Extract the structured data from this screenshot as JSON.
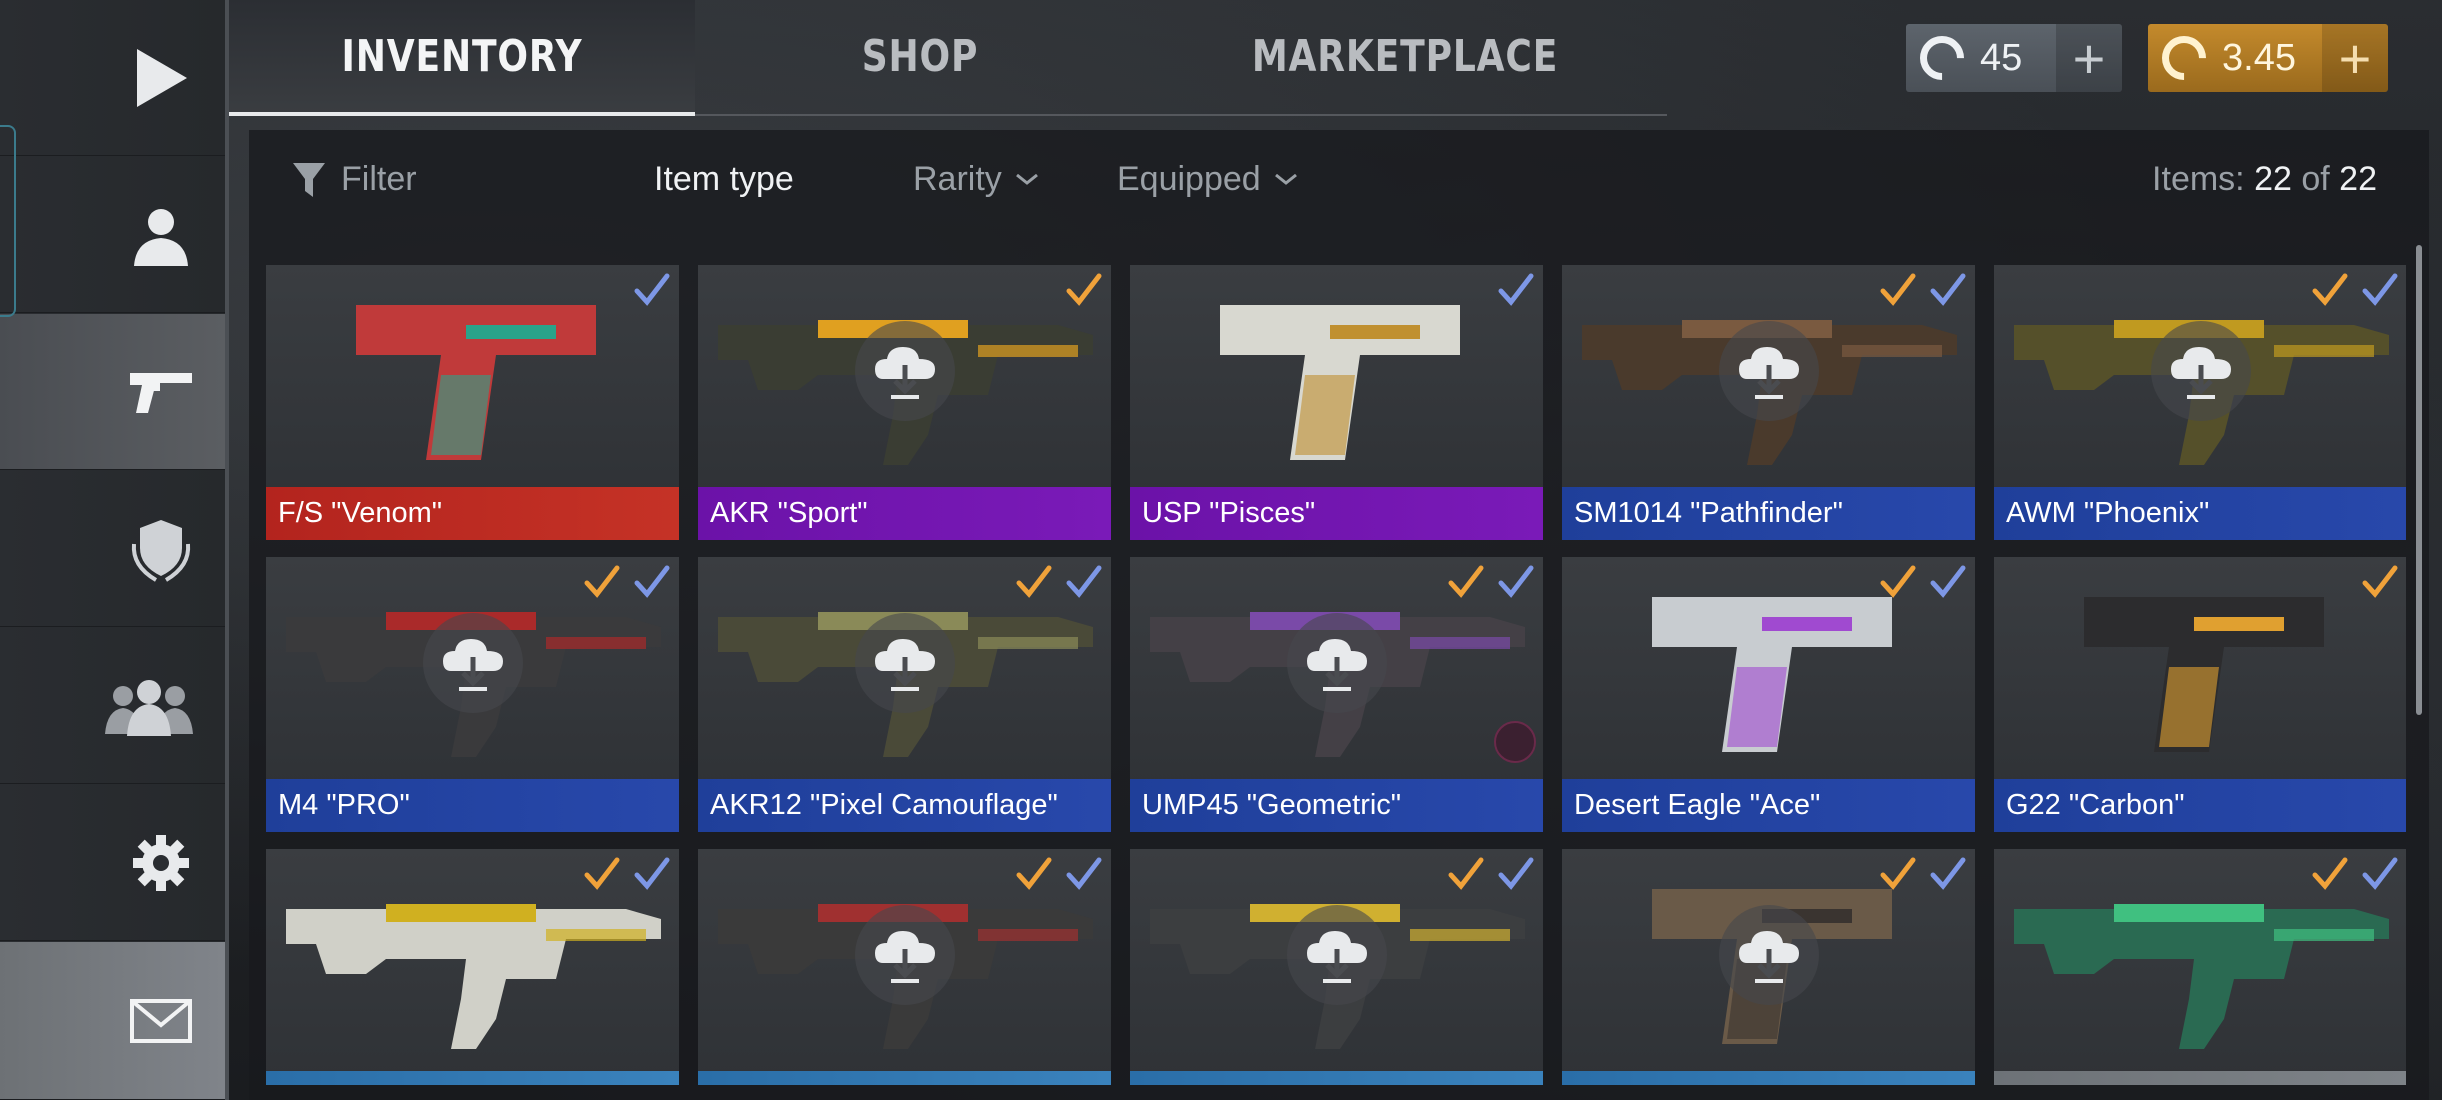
{
  "tabs": {
    "inventory": "INVENTORY",
    "shop": "SHOP",
    "marketplace": "MARKETPLACE"
  },
  "currency": {
    "credits": "45",
    "gold": "3.45",
    "plus": "+"
  },
  "filters": {
    "filter": "Filter",
    "item_type": "Item type",
    "rarity": "Rarity",
    "equipped": "Equipped",
    "items_label": "Items:",
    "items_count": "22",
    "items_of": "of",
    "items_total": "22"
  },
  "sidebar": [
    "play-icon",
    "profile-icon",
    "pistol-icon",
    "clan-shield-icon",
    "friends-icon",
    "settings-icon",
    "mail-icon"
  ],
  "colors": {
    "red": "#b3241e",
    "purple": "#6b12a8",
    "blue": "#1f3f9a",
    "light_blue": "#2a6ea8",
    "orange_check": "#f0a23a",
    "blue_check": "#7d97e6"
  },
  "items": [
    {
      "name": "F/S \"Venom\"",
      "rarity": "red",
      "orange_check": false,
      "blue_check": true,
      "download": false
    },
    {
      "name": "AKR \"Sport\"",
      "rarity": "purple",
      "orange_check": true,
      "blue_check": false,
      "download": true
    },
    {
      "name": "USP \"Pisces\"",
      "rarity": "purple",
      "orange_check": false,
      "blue_check": true,
      "download": false
    },
    {
      "name": "SM1014 \"Pathfinder\"",
      "rarity": "blue",
      "orange_check": true,
      "blue_check": true,
      "download": true
    },
    {
      "name": "AWM \"Phoenix\"",
      "rarity": "blue",
      "orange_check": true,
      "blue_check": true,
      "download": true
    },
    {
      "name": "M4 \"PRO\"",
      "rarity": "blue",
      "orange_check": true,
      "blue_check": true,
      "download": true
    },
    {
      "name": "AKR12 \"Pixel Camouflage\"",
      "rarity": "blue",
      "orange_check": true,
      "blue_check": true,
      "download": true
    },
    {
      "name": "UMP45 \"Geometric\"",
      "rarity": "blue",
      "orange_check": true,
      "blue_check": true,
      "download": true,
      "badge": true
    },
    {
      "name": "Desert Eagle \"Ace\"",
      "rarity": "blue",
      "orange_check": true,
      "blue_check": true,
      "download": false
    },
    {
      "name": "G22 \"Carbon\"",
      "rarity": "blue",
      "orange_check": true,
      "blue_check": false,
      "download": false
    },
    {
      "name": "",
      "rarity": "lblue",
      "orange_check": true,
      "blue_check": true,
      "download": false
    },
    {
      "name": "",
      "rarity": "lblue",
      "orange_check": true,
      "blue_check": true,
      "download": true
    },
    {
      "name": "",
      "rarity": "lblue",
      "orange_check": true,
      "blue_check": true,
      "download": true
    },
    {
      "name": "",
      "rarity": "lblue",
      "orange_check": true,
      "blue_check": true,
      "download": true
    },
    {
      "name": "",
      "rarity": "grey",
      "orange_check": true,
      "blue_check": true,
      "download": false
    }
  ]
}
